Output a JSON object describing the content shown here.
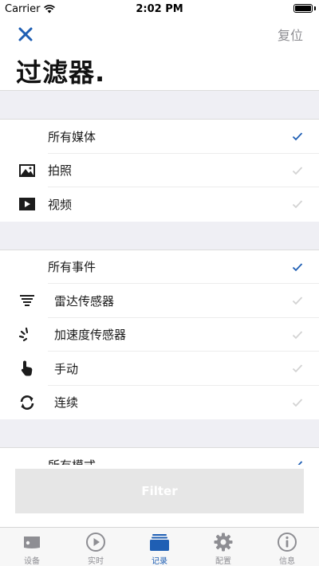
{
  "status_bar": {
    "carrier": "Carrier",
    "time": "2:02 PM"
  },
  "nav": {
    "close_icon": "close-icon",
    "reset_label": "复位"
  },
  "page": {
    "title": "过滤器."
  },
  "colors": {
    "accent": "#1f5fb4",
    "check_active": "#1f5fb4",
    "check_inactive": "#d3d3d3",
    "tab_inactive": "#8e8e93",
    "section_gap": "#efeff4"
  },
  "media_section": {
    "all_label": "所有媒体",
    "items": [
      {
        "label": "拍照",
        "icon": "photo-icon"
      },
      {
        "label": "视频",
        "icon": "video-icon"
      }
    ]
  },
  "event_section": {
    "all_label": "所有事件",
    "items": [
      {
        "label": "雷达传感器",
        "icon": "radar-sensor-icon"
      },
      {
        "label": "加速度传感器",
        "icon": "accelerometer-icon"
      },
      {
        "label": "手动",
        "icon": "manual-hand-icon"
      },
      {
        "label": "连续",
        "icon": "continuous-icon"
      }
    ]
  },
  "mode_section": {
    "all_label": "所有模式"
  },
  "filter_button": {
    "label": "Filter"
  },
  "tabbar": {
    "tabs": [
      {
        "label": "设备",
        "icon": "device-icon"
      },
      {
        "label": "实时",
        "icon": "play-icon"
      },
      {
        "label": "记录",
        "icon": "records-icon",
        "active": true
      },
      {
        "label": "配置",
        "icon": "gear-icon"
      },
      {
        "label": "信息",
        "icon": "info-icon"
      }
    ]
  }
}
